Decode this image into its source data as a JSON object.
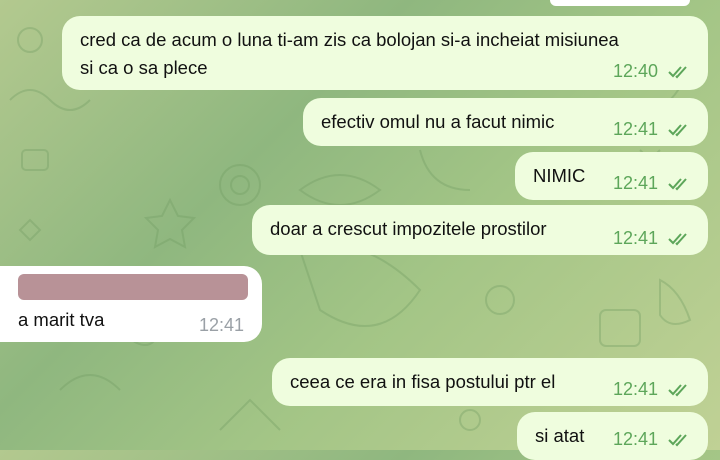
{
  "messages": [
    {
      "text_lines": [
        "cred ca de acum o luna ti-am zis ca bolojan si-a incheiat misiunea",
        "si ca o sa plece"
      ],
      "time": "12:40",
      "direction": "outgoing",
      "status": "read"
    },
    {
      "text_lines": [
        "efectiv omul nu a facut nimic"
      ],
      "time": "12:41",
      "direction": "outgoing",
      "status": "read"
    },
    {
      "text_lines": [
        "NIMIC"
      ],
      "time": "12:41",
      "direction": "outgoing",
      "status": "read"
    },
    {
      "text_lines": [
        "doar a crescut impozitele prostilor"
      ],
      "time": "12:41",
      "direction": "outgoing",
      "status": "read"
    },
    {
      "text_lines": [
        "a marit tva"
      ],
      "time": "12:41",
      "direction": "incoming",
      "sender_redacted": true
    },
    {
      "text_lines": [
        "ceea ce era in fisa postului ptr el"
      ],
      "time": "12:41",
      "direction": "outgoing",
      "status": "read"
    },
    {
      "text_lines": [
        "si atat"
      ],
      "time": "12:41",
      "direction": "outgoing",
      "status": "read"
    }
  ],
  "colors": {
    "outgoing_bubble": "#effdde",
    "incoming_bubble": "#ffffff",
    "outgoing_time": "#5da65a",
    "read_ticks": "#5da65a",
    "incoming_time": "#9aa0a6",
    "redaction": "#b89297"
  },
  "icons": {
    "read_status": "double-check-icon"
  }
}
